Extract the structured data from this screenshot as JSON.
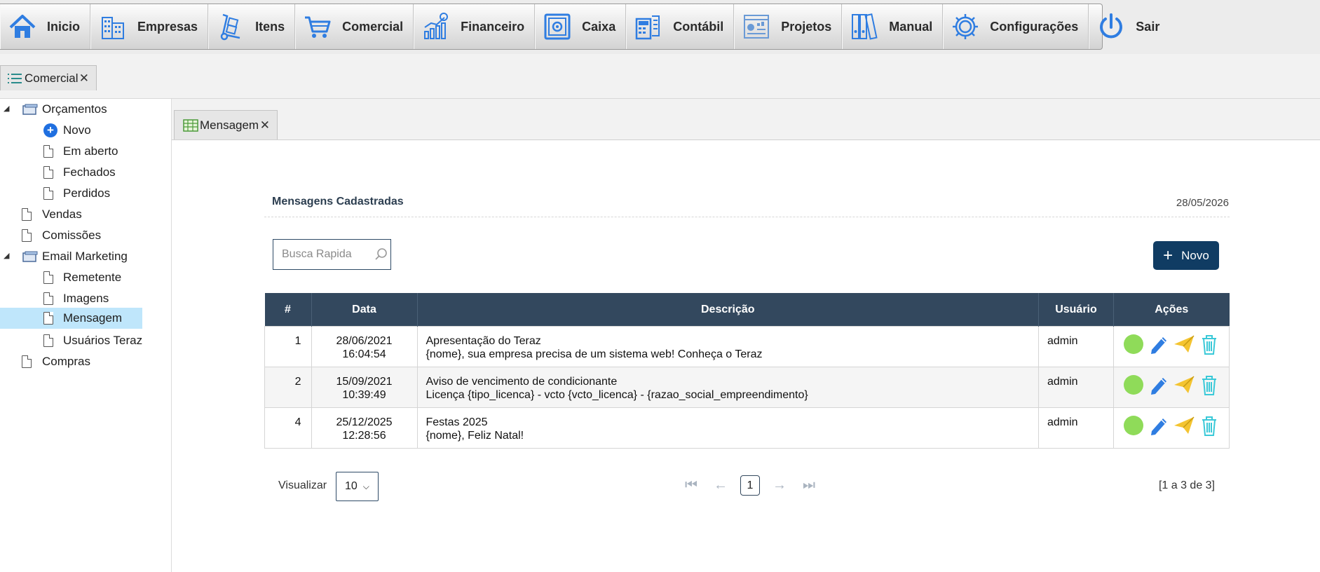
{
  "menu": [
    {
      "label": "Inicio",
      "icon": "home-icon"
    },
    {
      "label": "Empresas",
      "icon": "buildings-icon"
    },
    {
      "label": "Itens",
      "icon": "hand-truck-icon"
    },
    {
      "label": "Comercial",
      "icon": "cart-icon"
    },
    {
      "label": "Financeiro",
      "icon": "growth-chart-icon"
    },
    {
      "label": "Caixa",
      "icon": "safe-icon"
    },
    {
      "label": "Contábil",
      "icon": "calculator-icon"
    },
    {
      "label": "Projetos",
      "icon": "dashboard-icon"
    },
    {
      "label": "Manual",
      "icon": "binders-icon"
    },
    {
      "label": "Configurações",
      "icon": "gear-icon"
    },
    {
      "label": "Sair",
      "icon": "power-icon"
    }
  ],
  "module_tab": {
    "label": "Comercial",
    "close": "✕"
  },
  "sidebar": {
    "items": [
      {
        "label": "Orçamentos"
      },
      {
        "label": "Novo"
      },
      {
        "label": "Em aberto"
      },
      {
        "label": "Fechados"
      },
      {
        "label": "Perdidos"
      },
      {
        "label": "Vendas"
      },
      {
        "label": "Comissões"
      },
      {
        "label": "Email Marketing"
      },
      {
        "label": "Remetente"
      },
      {
        "label": "Imagens"
      },
      {
        "label": "Mensagem"
      },
      {
        "label": "Usuários Teraz"
      },
      {
        "label": "Compras"
      }
    ],
    "selected": "Mensagem"
  },
  "content_tab": {
    "label": "Mensagem",
    "close": "✕"
  },
  "panel": {
    "title": "Mensagens Cadastradas",
    "date": "28/05/2026",
    "search_placeholder": "Busca Rapida",
    "new_label": "Novo"
  },
  "table": {
    "headers": [
      "#",
      "Data",
      "Descrição",
      "Usuário",
      "Ações"
    ],
    "rows": [
      {
        "id": "1",
        "date": "28/06/2021",
        "time": "16:04:54",
        "title": "Apresentação do Teraz",
        "text": "{nome}, sua empresa precisa de um sistema web! Conheça o Teraz",
        "user": "admin"
      },
      {
        "id": "2",
        "date": "15/09/2021",
        "time": "10:39:49",
        "title": "Aviso de vencimento de condicionante",
        "text": "Licença {tipo_licenca} - vcto {vcto_licenca} - {razao_social_empreendimento}",
        "user": "admin"
      },
      {
        "id": "4",
        "date": "25/12/2025",
        "time": "12:28:56",
        "title": "Festas 2025",
        "text": "{nome}, Feliz Natal!",
        "user": "admin"
      }
    ]
  },
  "footer": {
    "view_label": "Visualizar",
    "page_size": "10",
    "current_page": "1",
    "range_text": "[1 a 3 de 3]"
  },
  "colors": {
    "accent": "#103c63",
    "header": "#33485e",
    "selected": "#bfe6fb",
    "icon_blue": "#2f7de1",
    "status_green": "#8fdb59",
    "send_yellow": "#f4c430",
    "delete_cyan": "#3ac9d8"
  }
}
